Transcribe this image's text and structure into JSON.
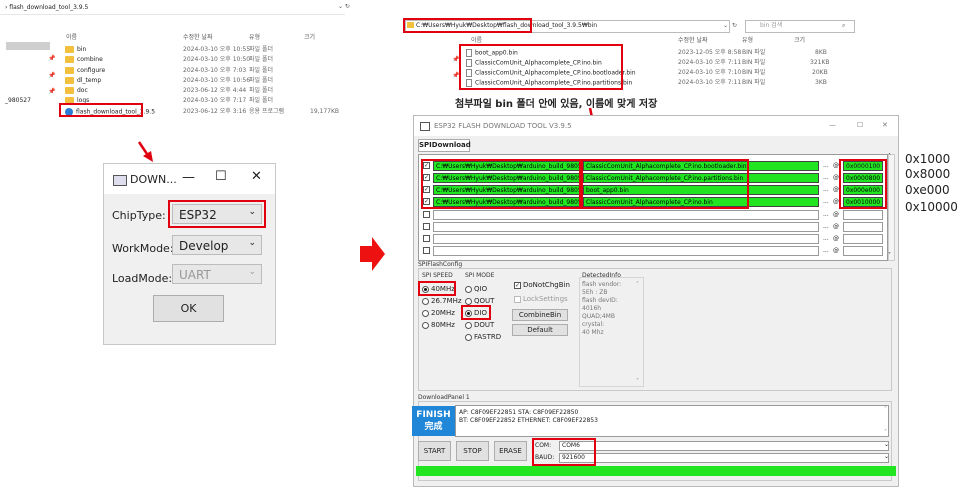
{
  "left_explorer": {
    "breadcrumb": "› flash_download_tool_3.9.5",
    "columns": [
      "이름",
      "수정한 날짜",
      "유형",
      "크기"
    ],
    "side_label": "_980527",
    "rows": [
      {
        "name": "bin",
        "date": "2024-03-10 오후 10:55",
        "type": "파일 폴더",
        "size": ""
      },
      {
        "name": "combine",
        "date": "2024-03-10 오후 10:50",
        "type": "파일 폴더",
        "size": ""
      },
      {
        "name": "configure",
        "date": "2024-03-10 오후 7:03",
        "type": "파일 폴더",
        "size": ""
      },
      {
        "name": "dl_temp",
        "date": "2024-03-10 오후 10:56",
        "type": "파일 폴더",
        "size": ""
      },
      {
        "name": "doc",
        "date": "2023-06-12 오후 4:44",
        "type": "파일 폴더",
        "size": ""
      },
      {
        "name": "logs",
        "date": "2024-03-10 오후 7:17",
        "type": "파일 폴더",
        "size": ""
      },
      {
        "name": "flash_download_tool_3.9.5",
        "date": "2023-06-12 오후 3:16",
        "type": "응용 프로그램",
        "size": "19,177KB"
      }
    ]
  },
  "mini_dialog": {
    "title": "DOWN...",
    "chip_label": "ChipType:",
    "chip_value": "ESP32",
    "work_label": "WorkMode:",
    "work_value": "Develop",
    "load_label": "LoadMode:",
    "load_value": "UART",
    "ok_label": "OK"
  },
  "right_explorer": {
    "path": "C:₩Users₩Hyuk₩Desktop₩flash_download_tool_3.9.5₩bin",
    "search_placeholder": "bin 검색",
    "columns": [
      "이름",
      "수정한 날짜",
      "유형",
      "크기"
    ],
    "rows": [
      {
        "name": "boot_app0.bin",
        "date": "2023-12-05 오후 8:58",
        "type": "BIN 파일",
        "size": "8KB"
      },
      {
        "name": "ClassicComUnit_Alphacomplete_CP.ino.bin",
        "date": "2024-03-10 오후 7:11",
        "type": "BIN 파일",
        "size": "321KB"
      },
      {
        "name": "ClassicComUnit_Alphacomplete_CP.ino.bootloader.bin",
        "date": "2024-03-10 오후 7:10",
        "type": "BIN 파일",
        "size": "20KB"
      },
      {
        "name": "ClassicComUnit_Alphacomplete_CP.ino.partitions.bin",
        "date": "2024-03-10 오후 7:11",
        "type": "BIN 파일",
        "size": "3KB"
      }
    ]
  },
  "annotation": "첨부파일 bin 폴더 안에 있음, 이름에 맞게 저장",
  "tool": {
    "title": "ESP32 FLASH DOWNLOAD TOOL V3.9.5",
    "tab": "SPIDownload",
    "rows": [
      {
        "checked": true,
        "path": "C:₩Users₩Hyuk₩Desktop₩arduino_build_980527₩",
        "file": "ClassicComUnit_Alphacomplete_CP.ino.bootloader.bin",
        "addr": "0x0000100"
      },
      {
        "checked": true,
        "path": "C:₩Users₩Hyuk₩Desktop₩arduino_build_980527₩",
        "file": "ClassicComUnit_Alphacomplete_CP.ino.partitions.bin",
        "addr": "0x0000800"
      },
      {
        "checked": true,
        "path": "C:₩Users₩Hyuk₩Desktop₩arduino_build_980527₩",
        "file": "boot_app0.bin",
        "addr": "0x000e000"
      },
      {
        "checked": true,
        "path": "C:₩Users₩Hyuk₩Desktop₩arduino_build_980527₩",
        "file": "ClassicComUnit_Alphacomplete_CP.ino.bin",
        "addr": "0x0010000"
      }
    ],
    "browse_label": "...",
    "at_label": "@",
    "spiflash_config": "SPIFlashConfig",
    "spi_speed_label": "SPI SPEED",
    "speeds": [
      {
        "label": "40MHz",
        "on": true
      },
      {
        "label": "26.7MHz",
        "on": false
      },
      {
        "label": "20MHz",
        "on": false
      },
      {
        "label": "80MHz",
        "on": false
      }
    ],
    "spi_mode_label": "SPI MODE",
    "modes": [
      {
        "label": "QIO",
        "on": false
      },
      {
        "label": "QOUT",
        "on": false
      },
      {
        "label": "DIO",
        "on": true
      },
      {
        "label": "DOUT",
        "on": false
      },
      {
        "label": "FASTRD",
        "on": false
      }
    ],
    "donotchgbin": "DoNotChgBin",
    "locksettings": "LockSettings",
    "combinebin": "CombineBin",
    "default": "Default",
    "detected_label": "DetectedInfo",
    "detected_lines": [
      "flash vendor:",
      "5Eh : ZB",
      "flash devID:",
      "4016h",
      "QUAD;4MB",
      "crystal:",
      "40 Mhz"
    ],
    "download_panel": "DownloadPanel 1",
    "finish_en": "FINISH",
    "finish_kr": "完成",
    "log_line1": "AP:  C8F09EF22851  STA:  C8F09EF22850",
    "log_line2": "BT:  C8F09EF22852  ETHERNET:  C8F09EF22853",
    "start": "START",
    "stop": "STOP",
    "erase": "ERASE",
    "com_label": "COM:",
    "com_value": "COM6",
    "baud_label": "BAUD:",
    "baud_value": "921600"
  },
  "addresses": [
    "0x1000",
    "0x8000",
    "0xe000",
    "0x10000"
  ],
  "colors": {
    "highlight_red": "#e00010",
    "progress_green": "#22e522",
    "finish_blue": "#1f86d8"
  }
}
